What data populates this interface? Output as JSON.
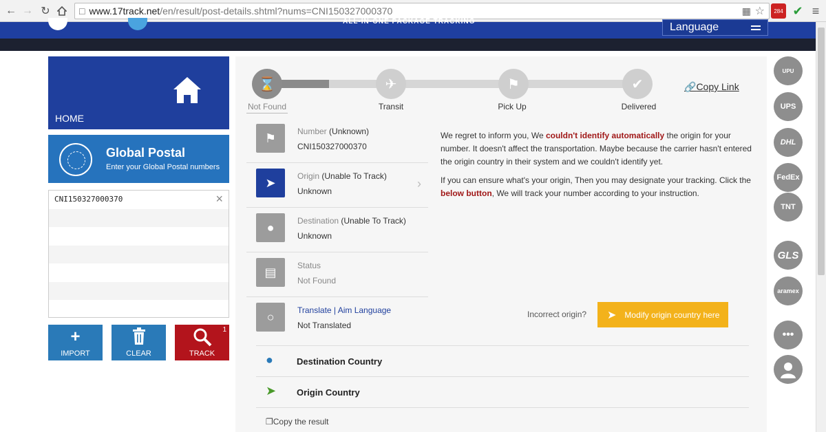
{
  "browser": {
    "url_host": "www.17track.net",
    "url_path": "/en/result/post-details.shtml?nums=CNI150327000370",
    "ext_badge": "284"
  },
  "header": {
    "tagline": "ALL-IN-ONE PACKAGE TRACKING",
    "language_label": "Language"
  },
  "sidebar": {
    "home_label": "HOME",
    "carrier_name": "Global Postal",
    "carrier_sub": "Enter your Global Postal numbers",
    "tracking_number": "CNI150327000370",
    "buttons": {
      "import": "IMPORT",
      "clear": "CLEAR",
      "track": "TRACK",
      "track_badge": "1"
    }
  },
  "progress": {
    "steps": [
      "Not Found",
      "Transit",
      "Pick Up",
      "Delivered"
    ],
    "copy_link": "Copy Link"
  },
  "info": [
    {
      "title": "Number",
      "qualifier": "(Unknown)",
      "value": "CNI150327000370"
    },
    {
      "title": "Origin",
      "qualifier": "(Unable To Track)",
      "value": "Unknown"
    },
    {
      "title": "Destination",
      "qualifier": "(Unable To Track)",
      "value": "Unknown"
    },
    {
      "title": "Status",
      "qualifier": "",
      "value": "Not Found"
    },
    {
      "title": "Translate | Aim Language",
      "qualifier": "",
      "value": "Not Translated"
    }
  ],
  "message": {
    "p1_a": "We regret to inform you, We ",
    "p1_em": "couldn't identify automatically",
    "p1_b": " the origin for your number. It doesn't affect the transportation. Maybe because the carrier hasn't entered the origin country in their system and we couldn't identify yet.",
    "p2_a": "If you can ensure what's your origin, Then you may designate your tracking. Click the ",
    "p2_em": "below button",
    "p2_b": ", We will track your number according to your instruction.",
    "incorrect_label": "Incorrect origin?",
    "modify_button": "Modify origin country here"
  },
  "countries": {
    "destination": "Destination Country",
    "origin": "Origin Country",
    "copy_result": "Copy the result"
  },
  "carriers": [
    "UPU",
    "UPS",
    "DHL",
    "FedEx",
    "TNT",
    "GLS",
    "aramex",
    "•••"
  ],
  "colors": {
    "brand_blue": "#1f3f9d",
    "accent_orange": "#f3b21b",
    "track_red": "#b3141c",
    "tool_blue": "#2a7ab8"
  }
}
